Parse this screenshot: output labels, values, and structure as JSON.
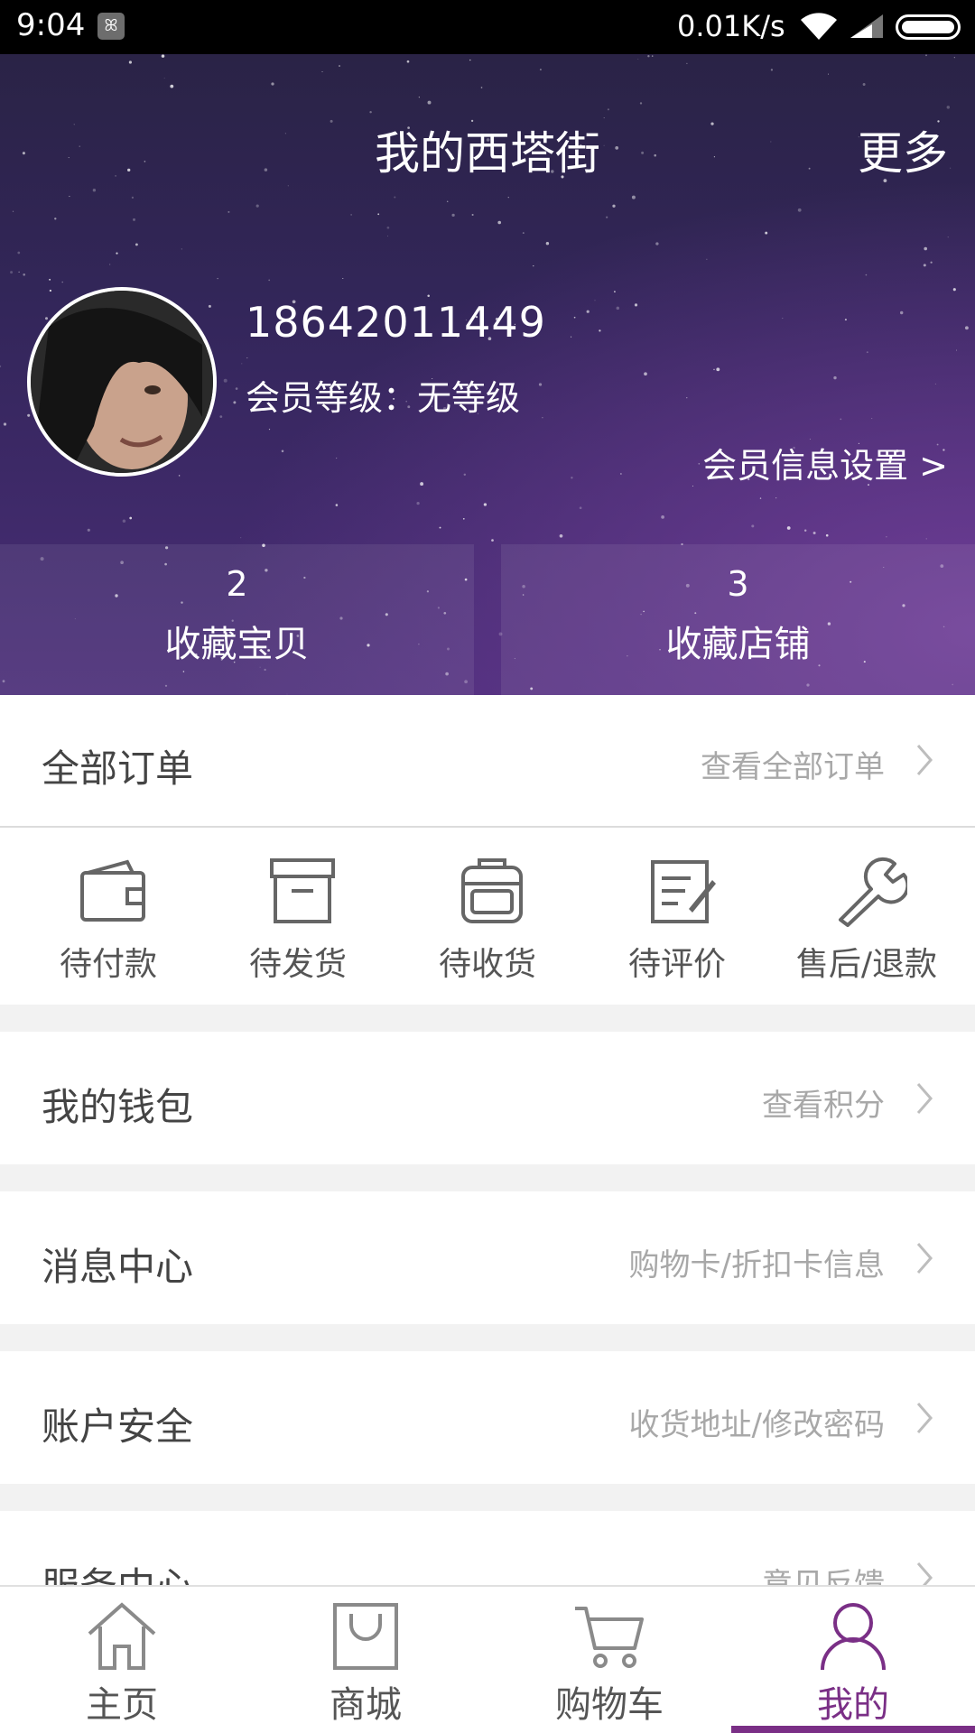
{
  "status_bar": {
    "time": "9:04",
    "network_speed": "0.01K/s"
  },
  "header": {
    "title": "我的西塔街",
    "more_label": "更多",
    "phone": "18642011449",
    "member_level": "会员等级：无等级",
    "member_settings": "会员信息设置 >",
    "favorites": [
      {
        "count": "2",
        "label": "收藏宝贝"
      },
      {
        "count": "3",
        "label": "收藏店铺"
      }
    ]
  },
  "orders": {
    "title": "全部订单",
    "link": "查看全部订单",
    "items": [
      {
        "label": "待付款",
        "icon": "wallet-icon"
      },
      {
        "label": "待发货",
        "icon": "box-icon"
      },
      {
        "label": "待收货",
        "icon": "backpack-icon"
      },
      {
        "label": "待评价",
        "icon": "edit-note-icon"
      },
      {
        "label": "售后/退款",
        "icon": "wrench-icon"
      }
    ]
  },
  "menu": [
    {
      "title": "我的钱包",
      "link": "查看积分"
    },
    {
      "title": "消息中心",
      "link": "购物卡/折扣卡信息"
    },
    {
      "title": "账户安全",
      "link": "收货地址/修改密码"
    },
    {
      "title": "服务中心",
      "link": "意见反馈"
    }
  ],
  "bottom_nav": {
    "items": [
      {
        "label": "主页",
        "icon": "home-icon"
      },
      {
        "label": "商城",
        "icon": "shopping-bag-icon"
      },
      {
        "label": "购物车",
        "icon": "cart-icon"
      },
      {
        "label": "我的",
        "icon": "person-icon"
      }
    ],
    "active_index": 3,
    "active_color": "#7a2f86"
  },
  "colors": {
    "accent": "#7a2f86",
    "header_bg": "#33265a",
    "muted_text": "#a8a8a8"
  }
}
